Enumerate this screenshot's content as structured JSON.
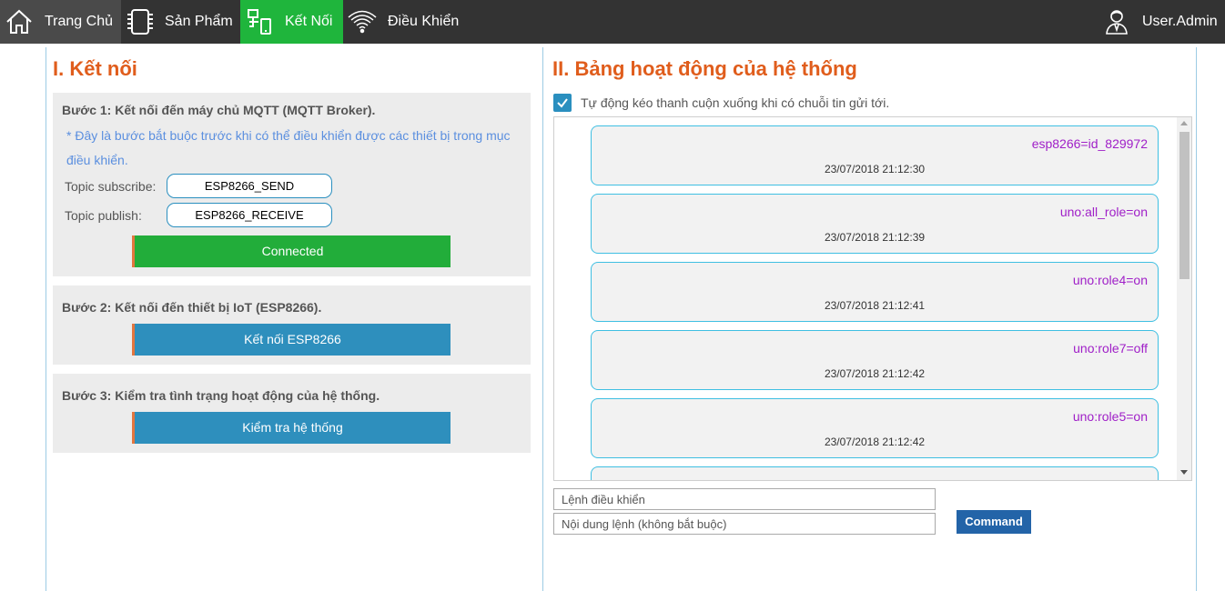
{
  "navbar": {
    "items": [
      {
        "label": "Trang Chủ",
        "icon": "home-icon"
      },
      {
        "label": "Sản Phẩm",
        "icon": "chip-icon"
      },
      {
        "label": "Kết Nối",
        "icon": "network-icon",
        "active": true
      },
      {
        "label": "Điều Khiển",
        "icon": "wifi-icon"
      }
    ],
    "user": {
      "label": "User.Admin",
      "icon": "user-icon"
    },
    "colors": {
      "background": "#333333",
      "active": "#1fb53c",
      "home_bg": "#4a4a4a"
    }
  },
  "connect": {
    "title": "I. Kết nối",
    "step1": {
      "title": "Bước 1: Kết nối đến máy chủ MQTT (MQTT Broker).",
      "note": "* Đây là bước bắt buộc trước khi có thể điều khiển được các thiết bị trong mục điều khiển.",
      "subscribe_label": "Topic subscribe:",
      "subscribe_value": "ESP8266_SEND",
      "publish_label": "Topic publish:",
      "publish_value": "ESP8266_RECEIVE",
      "button": "Connected"
    },
    "step2": {
      "title": "Bước 2: Kết nối đến thiết bị IoT (ESP8266).",
      "button": "Kết nối ESP8266"
    },
    "step3": {
      "title": "Bước 3: Kiểm tra tình trạng hoạt động của hệ thống.",
      "button": "Kiểm tra hệ thống"
    }
  },
  "activity": {
    "title": "II. Bảng hoạt động của hệ thống",
    "autoscroll_label": "Tự động kéo thanh cuộn xuống khi có chuỗi tin gửi tới.",
    "autoscroll_checked": true,
    "log": [
      {
        "message": "esp8266=id_829972",
        "time": "23/07/2018 21:12:30"
      },
      {
        "message": "uno:all_role=on",
        "time": "23/07/2018 21:12:39"
      },
      {
        "message": "uno:role4=on",
        "time": "23/07/2018 21:12:41"
      },
      {
        "message": "uno:role7=off",
        "time": "23/07/2018 21:12:42"
      },
      {
        "message": "uno:role5=on",
        "time": "23/07/2018 21:12:42"
      },
      {
        "message": "",
        "time": ""
      }
    ],
    "command_placeholder": "Lệnh điều khiển",
    "content_placeholder": "Nội dung lệnh (không bắt buộc)",
    "command_button": "Command",
    "colors": {
      "title": "#e05d1c",
      "message": "#a020c8",
      "border": "#3fbfe2"
    }
  }
}
